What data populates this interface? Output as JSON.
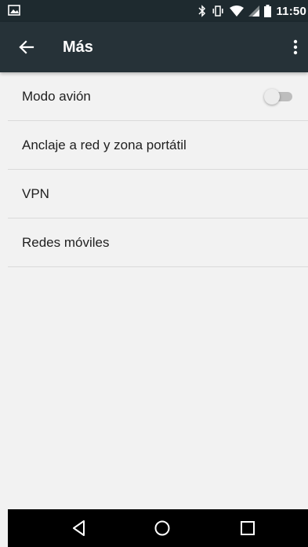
{
  "status_bar": {
    "time": "11:50",
    "icons": [
      "image-notification-icon",
      "bluetooth-icon",
      "vibrate-icon",
      "wifi-icon",
      "cell-signal-icon",
      "battery-icon"
    ]
  },
  "toolbar": {
    "title": "Más",
    "back_icon": "arrow-back-icon",
    "overflow_icon": "more-vert-icon"
  },
  "list": {
    "items": [
      {
        "label": "Modo avión",
        "toggle": false
      },
      {
        "label": "Anclaje a red y zona portátil"
      },
      {
        "label": "VPN"
      },
      {
        "label": "Redes móviles"
      }
    ]
  },
  "nav_bar": {
    "icons": [
      "nav-back-icon",
      "nav-home-icon",
      "nav-recents-icon"
    ]
  },
  "colors": {
    "status_bar": "#1e2a2f",
    "toolbar": "#263238",
    "background": "#f2f2f2",
    "divider": "#dadada",
    "text": "#212121"
  }
}
